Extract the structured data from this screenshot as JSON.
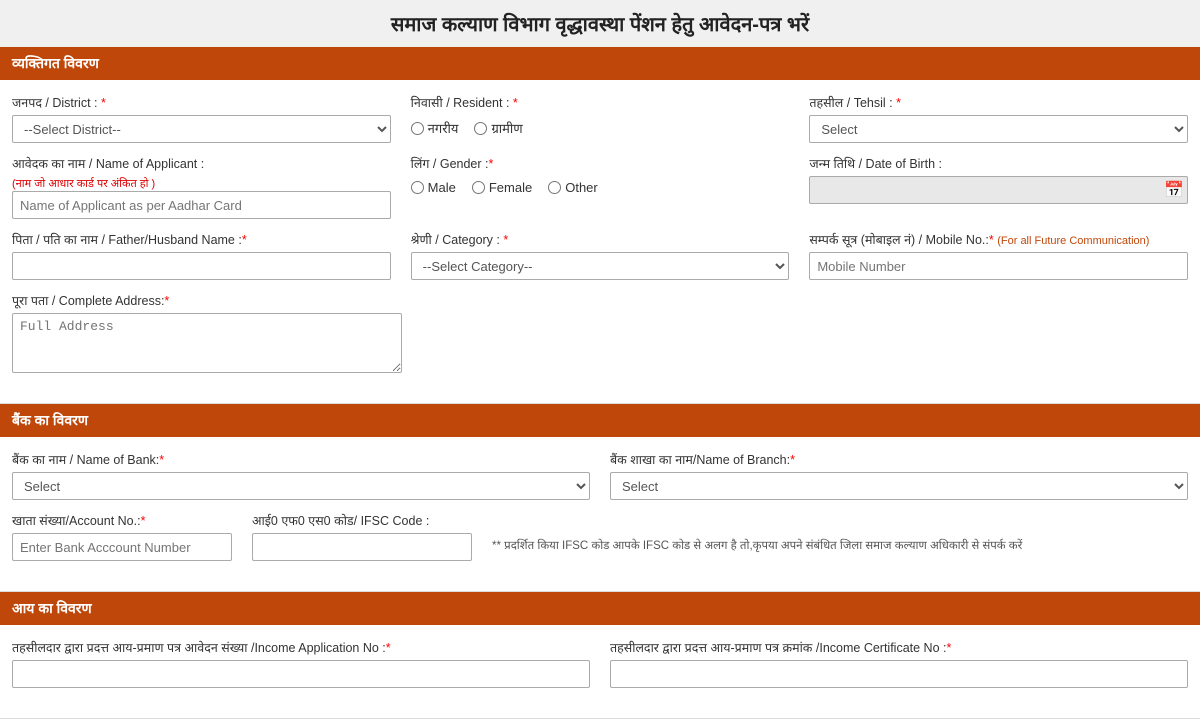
{
  "page": {
    "title": "समाज कल्याण विभाग वृद्धावस्था पेंशन हेतु आवेदन-पत्र भरें"
  },
  "sections": {
    "personal": {
      "header": "व्यक्तिगत विवरण",
      "district_label": "जनपद / District :",
      "district_placeholder": "--Select District--",
      "resident_label": "निवासी / Resident :",
      "resident_options": [
        "नगरीय",
        "ग्रामीण"
      ],
      "tehsil_label": "तहसील / Tehsil :",
      "tehsil_placeholder": "Select",
      "applicant_name_label": "आवेदक का नाम / Name of Applicant :",
      "applicant_name_note": "(नाम जो आधार कार्ड पर अंकित हो )",
      "applicant_name_placeholder": "Name of Applicant as per Aadhar Card",
      "gender_label": "लिंग / Gender :",
      "gender_options": [
        "Male",
        "Female",
        "Other"
      ],
      "dob_label": "जन्म तिथि / Date of Birth :",
      "father_husband_label": "पिता / पति का नाम / Father/Husband Name :",
      "category_label": "श्रेणी / Category :",
      "category_placeholder": "--Select Category--",
      "mobile_label": "सम्पर्क सूत्र (मोबाइल नं) / Mobile No.:",
      "mobile_note": "(For all Future Communication)",
      "mobile_placeholder": "Mobile Number",
      "address_label": "पूरा पता / Complete Address:",
      "address_placeholder": "Full Address"
    },
    "bank": {
      "header": "बैंक का विवरण",
      "bank_name_label": "बैंक का नाम / Name of Bank:",
      "bank_name_placeholder": "Select",
      "branch_name_label": "बैंक शाखा का नाम/Name of Branch:",
      "branch_name_placeholder": "Select",
      "account_no_label": "खाता संख्या/Account No.:",
      "account_no_placeholder": "Enter Bank Acccount Number",
      "ifsc_label": "आई0 एफ0 एस0 कोड/ IFSC Code :",
      "ifsc_note": "** प्रदर्शित किया IFSC कोड आपके IFSC कोड से अलग है तो,कृपया अपने संबंधित जिला समाज कल्याण अधिकारी से संपर्क करें"
    },
    "income": {
      "header": "आय का विवरण",
      "income_app_no_label": "तहसीलदार द्वारा प्रदत्त आय-प्रमाण पत्र आवेदन संख्या /Income Application No :",
      "income_cert_no_label": "तहसीलदार द्वारा प्रदत्त आय-प्रमाण पत्र क्रमांक /Income Certificate No :"
    }
  }
}
